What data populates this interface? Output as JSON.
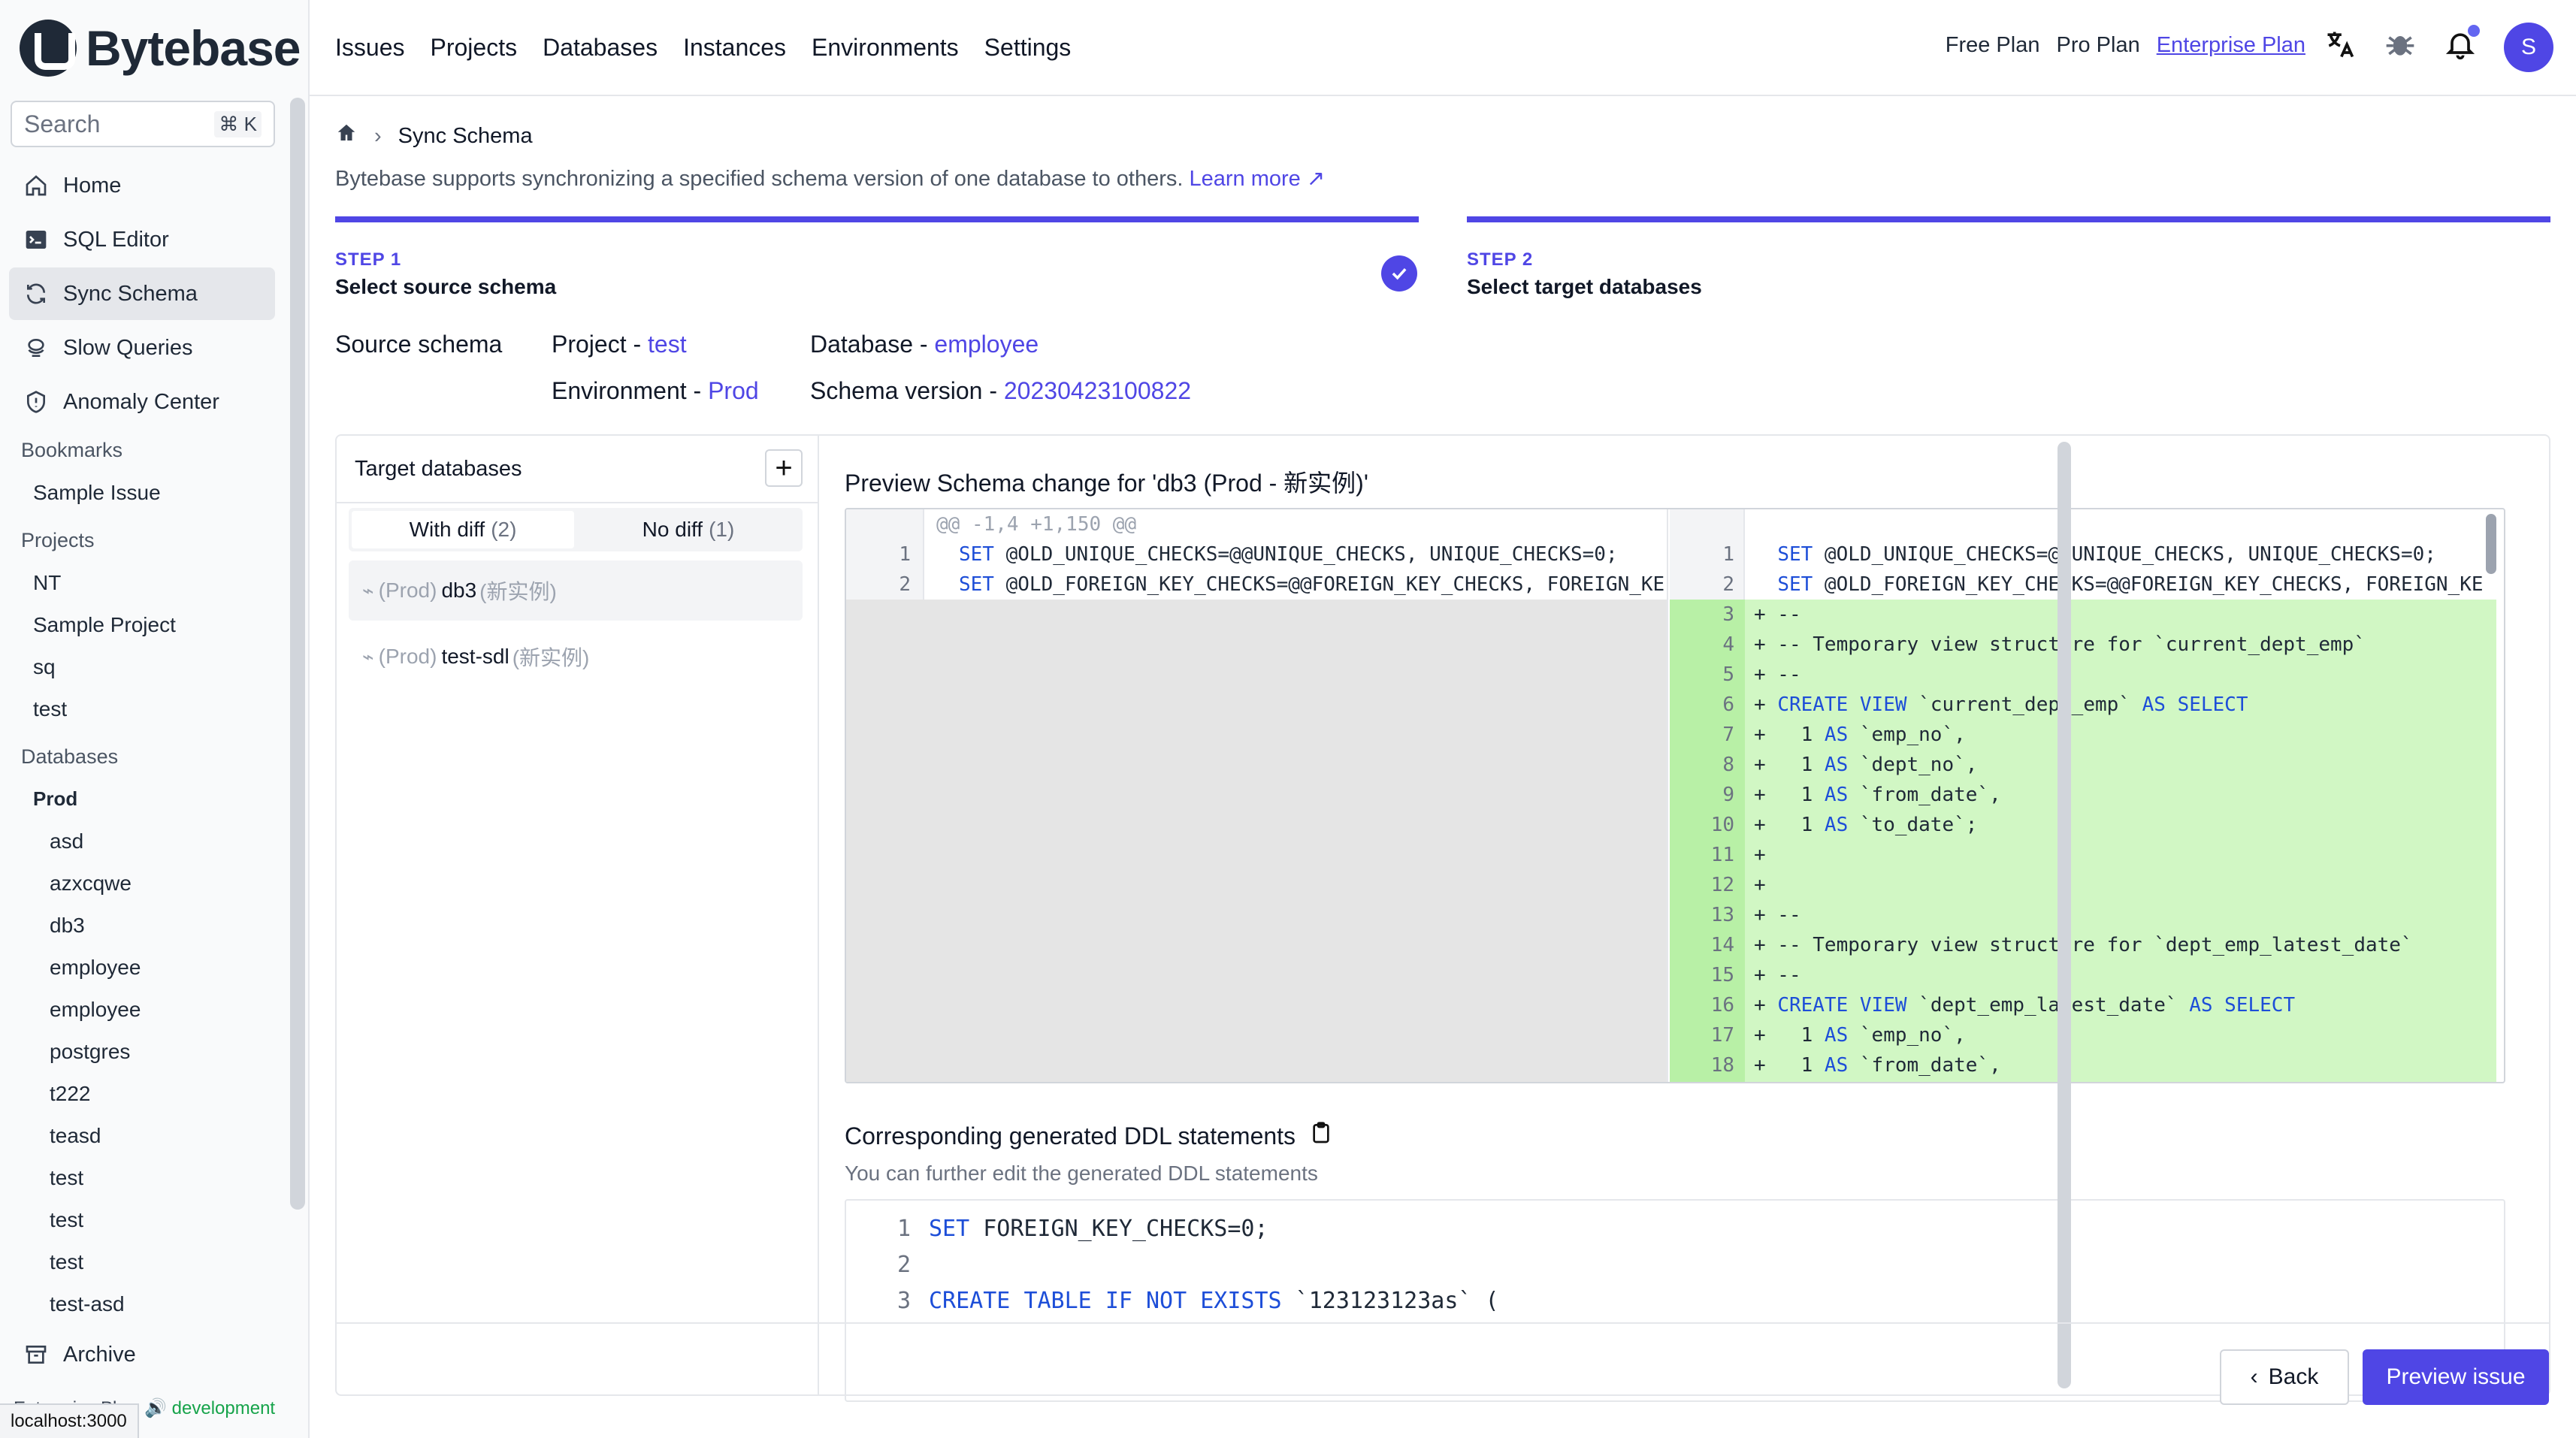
{
  "app": {
    "logo_text": "Bytebase",
    "status_url": "localhost:3000"
  },
  "sidebar": {
    "search_placeholder": "Search",
    "search_shortcut": "⌘ K",
    "nav": [
      {
        "label": "Home",
        "icon": "home-icon"
      },
      {
        "label": "SQL Editor",
        "icon": "terminal-icon"
      },
      {
        "label": "Sync Schema",
        "icon": "sync-icon"
      },
      {
        "label": "Slow Queries",
        "icon": "slow-query-icon"
      },
      {
        "label": "Anomaly Center",
        "icon": "shield-icon"
      }
    ],
    "bookmarks_header": "Bookmarks",
    "bookmarks": [
      "Sample Issue"
    ],
    "projects_header": "Projects",
    "projects": [
      "NT",
      "Sample Project",
      "sq",
      "test"
    ],
    "databases_header": "Databases",
    "env_group": "Prod",
    "databases": [
      "asd",
      "azxcqwe",
      "db3",
      "employee",
      "employee",
      "postgres",
      "t222",
      "teasd",
      "test",
      "test",
      "test",
      "test-asd"
    ],
    "archive_label": "Archive",
    "footer_plan": "Enterprise Plan",
    "footer_env": "development"
  },
  "topbar": {
    "nav": [
      "Issues",
      "Projects",
      "Databases",
      "Instances",
      "Environments",
      "Settings"
    ],
    "plans": {
      "free": "Free Plan",
      "pro": "Pro Plan",
      "enterprise": "Enterprise Plan"
    },
    "avatar_initial": "S"
  },
  "page": {
    "breadcrumb": "Sync Schema",
    "description": "Bytebase supports synchronizing a specified schema version of one database to others.",
    "learn_more": "Learn more",
    "steps": [
      {
        "label": "STEP 1",
        "title": "Select source schema"
      },
      {
        "label": "STEP 2",
        "title": "Select target databases"
      }
    ],
    "source": {
      "label": "Source schema",
      "project_label": "Project - ",
      "project": "test",
      "database_label": "Database - ",
      "database": "employee",
      "environment_label": "Environment - ",
      "environment": "Prod",
      "schema_version_label": "Schema version - ",
      "schema_version": "20230423100822"
    },
    "target": {
      "header": "Target databases",
      "tab_with_diff": "With diff",
      "tab_with_diff_count": "(2)",
      "tab_no_diff": "No diff",
      "tab_no_diff_count": "(1)",
      "rows": [
        {
          "env": "(Prod)",
          "name": "db3",
          "instance": "(新实例)"
        },
        {
          "env": "(Prod)",
          "name": "test-sdl",
          "instance": "(新实例)"
        }
      ]
    },
    "preview": {
      "title": "Preview Schema change for 'db3 (Prod - 新实例)'",
      "hunk_header": "@@ -1,4 +1,150 @@",
      "left_lines": [
        {
          "n": "1",
          "text": "SET @OLD_UNIQUE_CHECKS=@@UNIQUE_CHECKS, UNIQUE_CHECKS=0;"
        },
        {
          "n": "2",
          "text": "SET @OLD_FOREIGN_KEY_CHECKS=@@FOREIGN_KEY_CHECKS, FOREIGN_KE"
        }
      ],
      "right_lines": [
        {
          "n": "1",
          "text": "  SET @OLD_UNIQUE_CHECKS=@@UNIQUE_CHECKS, UNIQUE_CHECKS=0;"
        },
        {
          "n": "2",
          "text": "  SET @OLD_FOREIGN_KEY_CHECKS=@@FOREIGN_KEY_CHECKS, FOREIGN_KE"
        },
        {
          "n": "3",
          "text": "+ --"
        },
        {
          "n": "4",
          "text": "+ -- Temporary view structure for `current_dept_emp`"
        },
        {
          "n": "5",
          "text": "+ --"
        },
        {
          "n": "6",
          "text": "+ CREATE VIEW `current_dept_emp` AS SELECT"
        },
        {
          "n": "7",
          "text": "+   1 AS `emp_no`,"
        },
        {
          "n": "8",
          "text": "+   1 AS `dept_no`,"
        },
        {
          "n": "9",
          "text": "+   1 AS `from_date`,"
        },
        {
          "n": "10",
          "text": "+   1 AS `to_date`;"
        },
        {
          "n": "11",
          "text": "+"
        },
        {
          "n": "12",
          "text": "+"
        },
        {
          "n": "13",
          "text": "+ --"
        },
        {
          "n": "14",
          "text": "+ -- Temporary view structure for `dept_emp_latest_date`"
        },
        {
          "n": "15",
          "text": "+ --"
        },
        {
          "n": "16",
          "text": "+ CREATE VIEW `dept_emp_latest_date` AS SELECT"
        },
        {
          "n": "17",
          "text": "+   1 AS `emp_no`,"
        },
        {
          "n": "18",
          "text": "+   1 AS `from_date`,"
        }
      ]
    },
    "ddl": {
      "title": "Corresponding generated DDL statements",
      "subtitle": "You can further edit the generated DDL statements",
      "lines": [
        {
          "n": "1",
          "text": "SET FOREIGN_KEY_CHECKS=0;"
        },
        {
          "n": "2",
          "text": ""
        },
        {
          "n": "3",
          "text": "CREATE TABLE IF NOT EXISTS `123123123as` ("
        }
      ]
    },
    "buttons": {
      "back": "Back",
      "preview_issue": "Preview issue"
    }
  },
  "colors": {
    "accent": "#4f46e5",
    "diff_added": "#d1f7c4",
    "diff_added_gutter": "#b8f0a6"
  }
}
